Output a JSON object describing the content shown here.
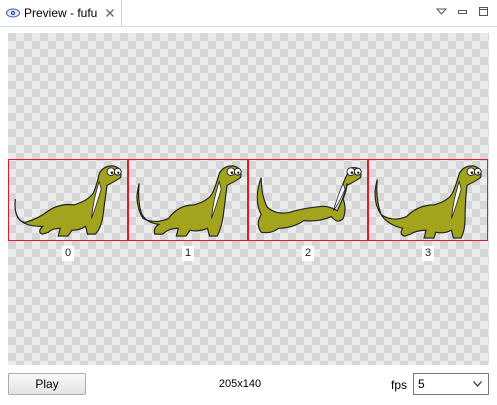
{
  "tab": {
    "title": "Preview - fufu",
    "icon": "eye-icon"
  },
  "frames": [
    {
      "label": "0"
    },
    {
      "label": "1"
    },
    {
      "label": "2"
    },
    {
      "label": "3"
    }
  ],
  "footer": {
    "play_label": "Play",
    "dimensions": "205x140",
    "fps_label": "fps",
    "fps_value": "5"
  },
  "colors": {
    "frame_border": "#e41b23",
    "dino_body": "#a3a41d",
    "dino_belly": "#ffffff"
  }
}
